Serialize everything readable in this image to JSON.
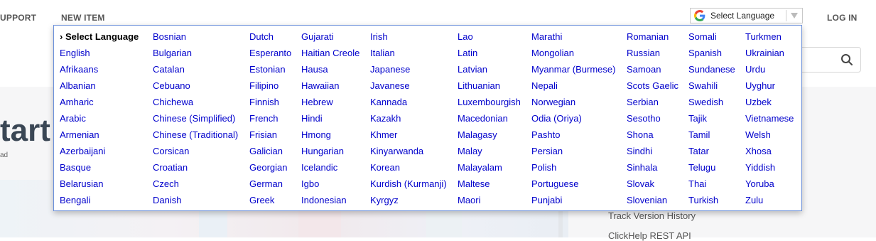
{
  "header": {
    "support_label": "UPPORT",
    "new_item_label": "NEW ITEM",
    "login_label": "LOG IN",
    "language_select_label": "Select Language"
  },
  "hero": {
    "title": "tart",
    "subtitle": "ad"
  },
  "sidebar": {
    "links": [
      "Track Version History",
      "ClickHelp REST API"
    ]
  },
  "colors": {
    "link": "#0000cc",
    "menu_border": "#6b90da",
    "title": "#3a4654"
  },
  "icons": {
    "language": "google-g-icon",
    "search": "search-icon",
    "dropdown": "caret-down-icon"
  },
  "language_menu": {
    "columns": [
      [
        "› Select Language",
        "English",
        "Afrikaans",
        "Albanian",
        "Amharic",
        "Arabic",
        "Armenian",
        "Azerbaijani",
        "Basque",
        "Belarusian",
        "Bengali"
      ],
      [
        "Bosnian",
        "Bulgarian",
        "Catalan",
        "Cebuano",
        "Chichewa",
        "Chinese (Simplified)",
        "Chinese (Traditional)",
        "Corsican",
        "Croatian",
        "Czech",
        "Danish"
      ],
      [
        "Dutch",
        "Esperanto",
        "Estonian",
        "Filipino",
        "Finnish",
        "French",
        "Frisian",
        "Galician",
        "Georgian",
        "German",
        "Greek"
      ],
      [
        "Gujarati",
        "Haitian Creole",
        "Hausa",
        "Hawaiian",
        "Hebrew",
        "Hindi",
        "Hmong",
        "Hungarian",
        "Icelandic",
        "Igbo",
        "Indonesian"
      ],
      [
        "Irish",
        "Italian",
        "Japanese",
        "Javanese",
        "Kannada",
        "Kazakh",
        "Khmer",
        "Kinyarwanda",
        "Korean",
        "Kurdish (Kurmanji)",
        "Kyrgyz"
      ],
      [
        "Lao",
        "Latin",
        "Latvian",
        "Lithuanian",
        "Luxembourgish",
        "Macedonian",
        "Malagasy",
        "Malay",
        "Malayalam",
        "Maltese",
        "Maori"
      ],
      [
        "Marathi",
        "Mongolian",
        "Myanmar (Burmese)",
        "Nepali",
        "Norwegian",
        "Odia (Oriya)",
        "Pashto",
        "Persian",
        "Polish",
        "Portuguese",
        "Punjabi"
      ],
      [
        "Romanian",
        "Russian",
        "Samoan",
        "Scots Gaelic",
        "Serbian",
        "Sesotho",
        "Shona",
        "Sindhi",
        "Sinhala",
        "Slovak",
        "Slovenian"
      ],
      [
        "Somali",
        "Spanish",
        "Sundanese",
        "Swahili",
        "Swedish",
        "Tajik",
        "Tamil",
        "Tatar",
        "Telugu",
        "Thai",
        "Turkish"
      ],
      [
        "Turkmen",
        "Ukrainian",
        "Urdu",
        "Uyghur",
        "Uzbek",
        "Vietnamese",
        "Welsh",
        "Xhosa",
        "Yiddish",
        "Yoruba",
        "Zulu"
      ]
    ]
  }
}
